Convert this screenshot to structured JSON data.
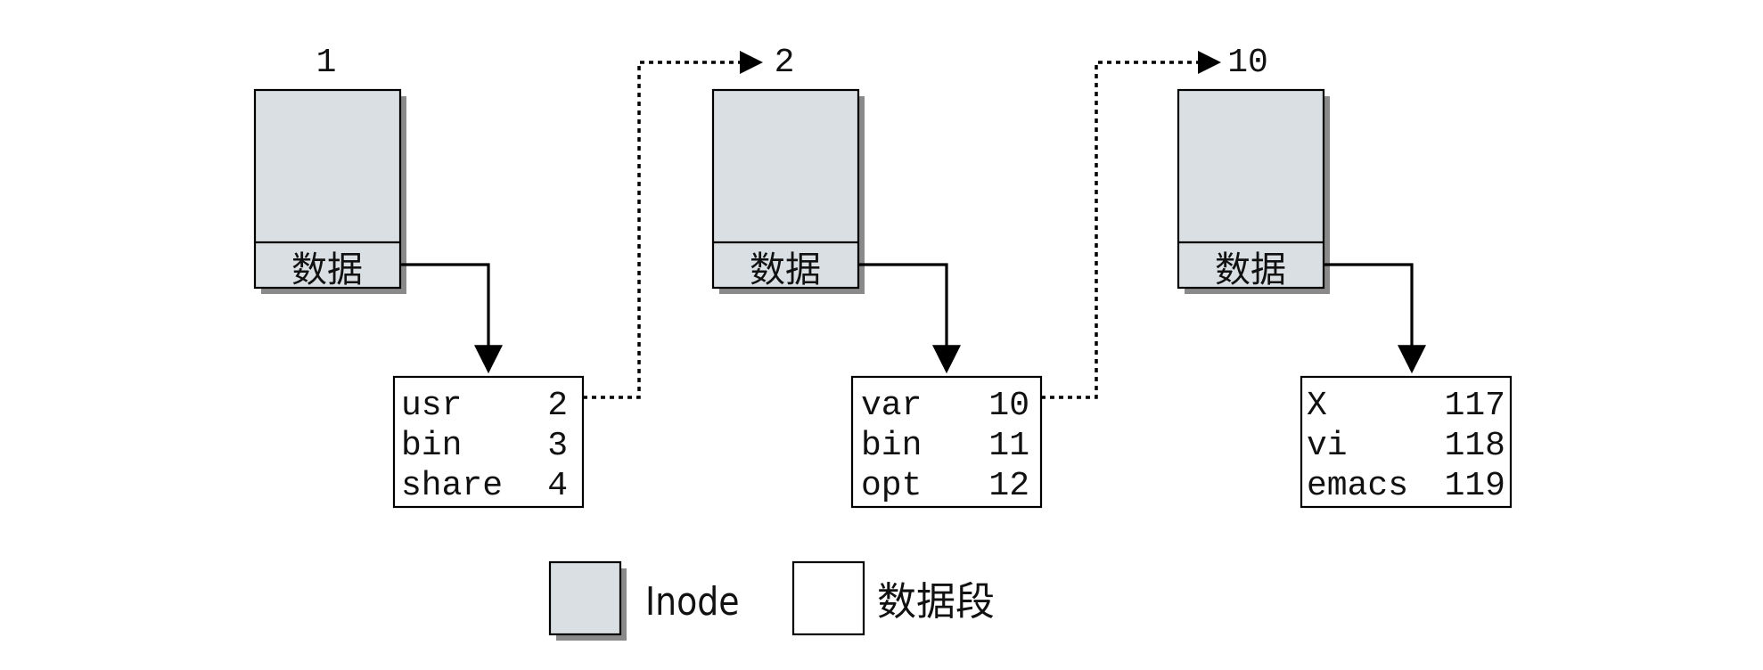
{
  "inodes": [
    {
      "number": "1",
      "data_label": "数据"
    },
    {
      "number": "2",
      "data_label": "数据"
    },
    {
      "number": "10",
      "data_label": "数据"
    }
  ],
  "blocks": [
    {
      "rows": [
        {
          "name": "usr",
          "inode": "2"
        },
        {
          "name": "bin",
          "inode": "3"
        },
        {
          "name": "share",
          "inode": "4"
        }
      ]
    },
    {
      "rows": [
        {
          "name": "var",
          "inode": "10"
        },
        {
          "name": "bin",
          "inode": "11"
        },
        {
          "name": "opt",
          "inode": "12"
        }
      ]
    },
    {
      "rows": [
        {
          "name": "X",
          "inode": "117"
        },
        {
          "name": "vi",
          "inode": "118"
        },
        {
          "name": "emacs",
          "inode": "119"
        }
      ]
    }
  ],
  "legend": {
    "inode_label": "Inode",
    "block_label": "数据段"
  },
  "colors": {
    "inode_fill": "#d9dfe2",
    "shadow": "#8a8a8a"
  }
}
